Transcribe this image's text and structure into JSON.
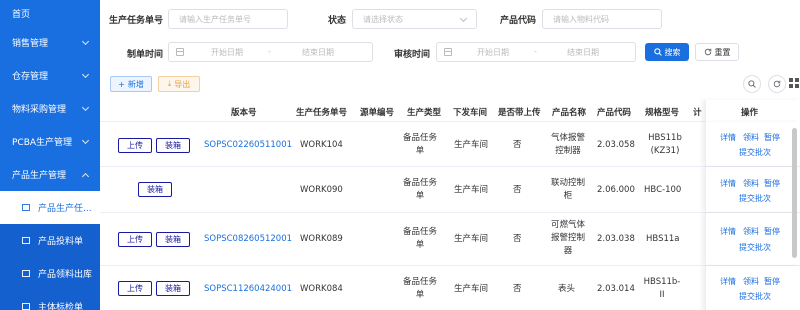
{
  "sidebar": {
    "items": [
      {
        "label": "首页"
      },
      {
        "label": "销售管理"
      },
      {
        "label": "仓存管理"
      },
      {
        "label": "物料采购管理"
      },
      {
        "label": "PCBA生产管理"
      },
      {
        "label": "产品生产管理"
      }
    ],
    "subitems": [
      {
        "label": "产品生产任..."
      },
      {
        "label": "产品投料单"
      },
      {
        "label": "产品领料出库"
      },
      {
        "label": "主体标检单"
      }
    ]
  },
  "filters": {
    "task_no_label": "生产任务单号",
    "task_no_placeholder": "请输入生产任务单号",
    "status_label": "状态",
    "status_placeholder": "请选择状态",
    "product_code_label": "产品代码",
    "product_code_placeholder": "请输入物料代码",
    "created_label": "制单时间",
    "audit_label": "审核时间",
    "start_placeholder": "开始日期",
    "end_placeholder": "结束日期",
    "range_sep": "-",
    "search": "搜索",
    "reset": "重置"
  },
  "toolbar": {
    "add": "新增",
    "export": "导出"
  },
  "table": {
    "columns": [
      "版本号",
      "生产任务单号",
      "源单编号",
      "生产类型",
      "下发车间",
      "是否带上传",
      "产品名称",
      "产品代码",
      "规格型号",
      "计",
      "操作"
    ],
    "rows": [
      {
        "btns": [
          "上传",
          "装箱"
        ],
        "version": "SOPSC02260511001",
        "task_no": "WORK104",
        "source": "",
        "type": "备品任务单",
        "workshop": "生产车间",
        "upload": "否",
        "name": "气体报警控制器",
        "code": "2.03.058",
        "spec": "HBS11b (KZ31)",
        "ops": [
          "详情",
          "领料",
          "暂停",
          "提交批次"
        ]
      },
      {
        "btns": [
          "装箱"
        ],
        "version": "",
        "task_no": "WORK090",
        "source": "",
        "type": "备品任务单",
        "workshop": "生产车间",
        "upload": "否",
        "name": "联动控制柜",
        "code": "2.06.000",
        "spec": "HBC-100",
        "ops": [
          "详情",
          "领料",
          "暂停",
          "提交批次"
        ]
      },
      {
        "btns": [
          "上传",
          "装箱"
        ],
        "version": "SOPSC08260512001",
        "task_no": "WORK089",
        "source": "",
        "type": "备品任务单",
        "workshop": "生产车间",
        "upload": "否",
        "name": "可燃气体报警控制器",
        "code": "2.03.038",
        "spec": "HBS11a",
        "ops": [
          "详情",
          "领料",
          "暂停",
          "提交批次"
        ]
      },
      {
        "btns": [
          "上传",
          "装箱"
        ],
        "version": "SOPSC11260424001",
        "task_no": "WORK084",
        "source": "",
        "type": "备品任务单",
        "workshop": "生产车间",
        "upload": "否",
        "name": "表头",
        "code": "2.03.014",
        "spec": "HBS11b-II",
        "ops": [
          "详情",
          "领料",
          "暂停",
          "提交批次"
        ]
      }
    ]
  },
  "icons": {
    "search": "search-icon",
    "refresh": "refresh-icon",
    "grid": "grid-icon",
    "calendar": "calendar-icon"
  },
  "colors": {
    "primary": "#1a6fe0",
    "sidebar": "#1a6fe0",
    "export": "#e6a23c"
  }
}
